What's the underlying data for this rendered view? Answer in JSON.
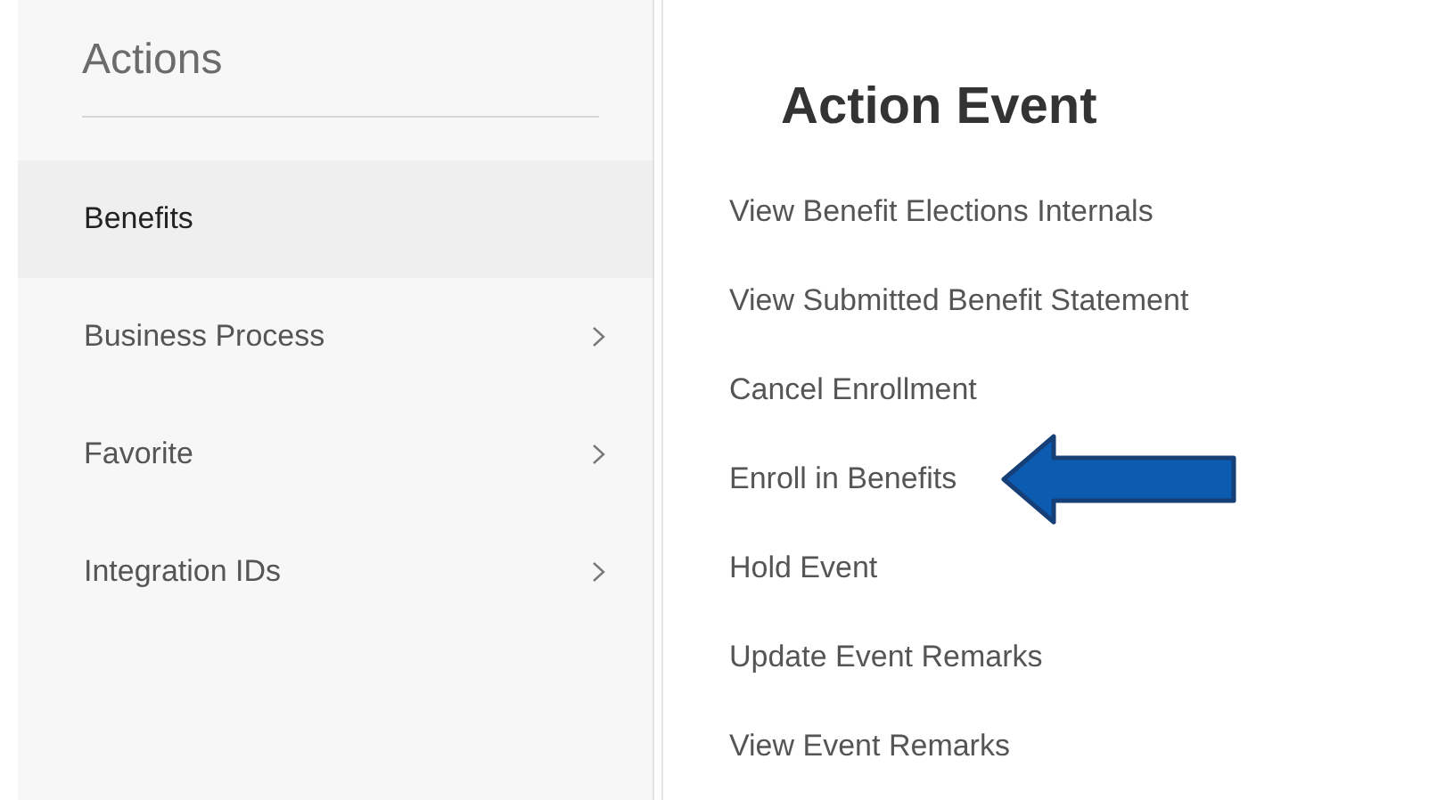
{
  "sidebar": {
    "title": "Actions",
    "items": [
      {
        "label": "Benefits",
        "selected": true,
        "expandable": false
      },
      {
        "label": "Business Process",
        "selected": false,
        "expandable": true
      },
      {
        "label": "Favorite",
        "selected": false,
        "expandable": true
      },
      {
        "label": "Integration IDs",
        "selected": false,
        "expandable": true
      }
    ]
  },
  "submenu": {
    "title": "Action Event",
    "items": [
      {
        "label": "View Benefit Elections Internals",
        "marked": false
      },
      {
        "label": "View Submitted Benefit Statement",
        "marked": false
      },
      {
        "label": "Cancel Enrollment",
        "marked": false
      },
      {
        "label": "Enroll in Benefits",
        "marked": true
      },
      {
        "label": "Hold Event",
        "marked": false
      },
      {
        "label": "Update Event Remarks",
        "marked": false
      },
      {
        "label": "View Event Remarks",
        "marked": false
      }
    ]
  }
}
